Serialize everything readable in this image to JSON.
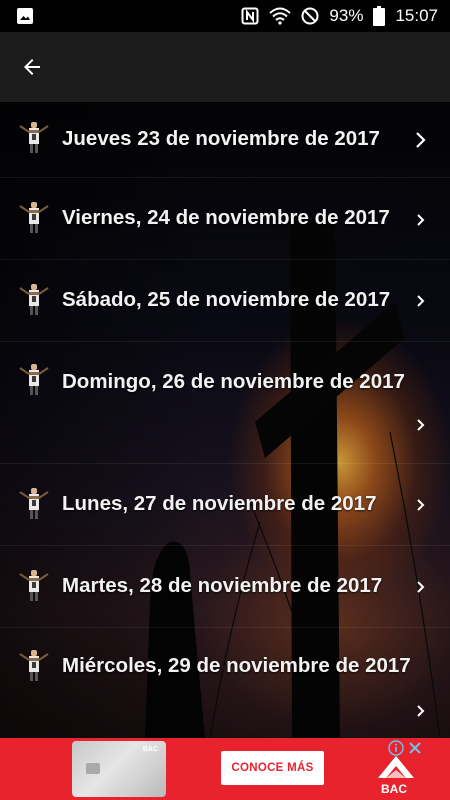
{
  "status_bar": {
    "battery_percent": "93%",
    "time": "15:07",
    "icons": [
      "image-icon",
      "nfc-icon",
      "wifi-icon",
      "do-not-disturb-icon",
      "battery-icon"
    ]
  },
  "toolbar": {
    "back_icon": "arrow-left-icon"
  },
  "list": {
    "items": [
      {
        "label": "Jueves 23 de noviembre de 2017",
        "icon": "saint-figure-icon"
      },
      {
        "label": "Viernes, 24 de noviembre de 2017",
        "icon": "saint-figure-icon"
      },
      {
        "label": "Sábado, 25 de noviembre de 2017",
        "icon": "saint-figure-icon"
      },
      {
        "label": "Domingo, 26 de noviembre de 2017",
        "icon": "saint-figure-icon"
      },
      {
        "label": "Lunes, 27 de noviembre de 2017",
        "icon": "saint-figure-icon"
      },
      {
        "label": "Martes, 28 de noviembre de 2017",
        "icon": "saint-figure-icon"
      },
      {
        "label": "Miércoles, 29 de noviembre de 2017",
        "icon": "saint-figure-icon"
      }
    ]
  },
  "ad": {
    "card_logo": "BAC",
    "cta_label": "CONOCE MÁS",
    "brand_label": "BAC",
    "accent_color": "#e8232e"
  }
}
